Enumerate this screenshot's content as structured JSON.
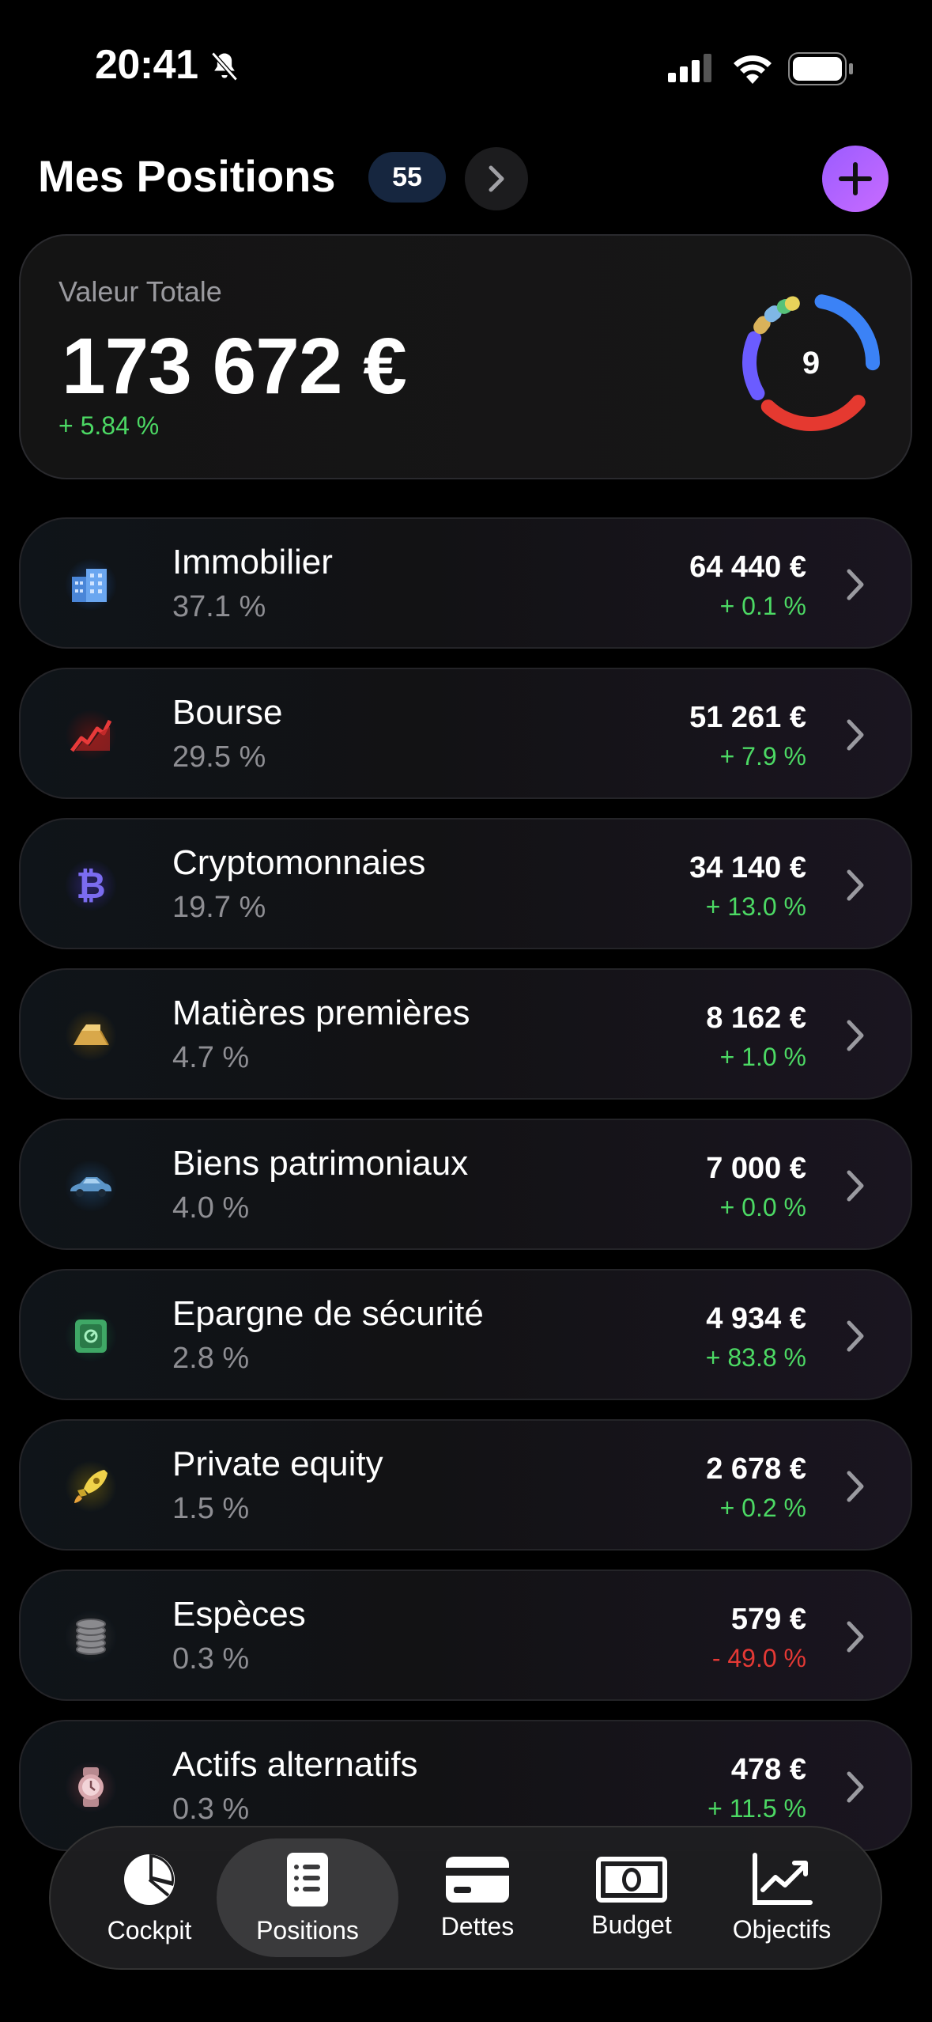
{
  "status": {
    "time": "20:41"
  },
  "header": {
    "title": "Mes Positions",
    "count": "55"
  },
  "total": {
    "label": "Valeur Totale",
    "value": "173 672 €",
    "change": "+ 5.84 %",
    "donut_count": "9"
  },
  "categories": [
    {
      "name": "Immobilier",
      "percent": "37.1 %",
      "amount": "64 440 €",
      "change": "+ 0.1 %",
      "trend": "pos",
      "icon": "building-icon"
    },
    {
      "name": "Bourse",
      "percent": "29.5 %",
      "amount": "51 261 €",
      "change": "+ 7.9 %",
      "trend": "pos",
      "icon": "stock-chart-icon"
    },
    {
      "name": "Cryptomonnaies",
      "percent": "19.7 %",
      "amount": "34 140 €",
      "change": "+ 13.0 %",
      "trend": "pos",
      "icon": "bitcoin-icon"
    },
    {
      "name": "Matières premières",
      "percent": "4.7 %",
      "amount": "8 162 €",
      "change": "+ 1.0 %",
      "trend": "pos",
      "icon": "gold-bar-icon"
    },
    {
      "name": "Biens patrimoniaux",
      "percent": "4.0 %",
      "amount": "7 000 €",
      "change": "+ 0.0 %",
      "trend": "pos",
      "icon": "car-icon"
    },
    {
      "name": "Epargne de sécurité",
      "percent": "2.8 %",
      "amount": "4 934 €",
      "change": "+ 83.8 %",
      "trend": "pos",
      "icon": "safe-icon"
    },
    {
      "name": "Private equity",
      "percent": "1.5 %",
      "amount": "2 678 €",
      "change": "+ 0.2 %",
      "trend": "pos",
      "icon": "rocket-icon"
    },
    {
      "name": "Espèces",
      "percent": "0.3 %",
      "amount": "579 €",
      "change": "- 49.0 %",
      "trend": "neg",
      "icon": "coins-icon"
    },
    {
      "name": "Actifs alternatifs",
      "percent": "0.3 %",
      "amount": "478 €",
      "change": "+ 11.5 %",
      "trend": "pos",
      "icon": "watch-icon"
    }
  ],
  "tabs": [
    {
      "label": "Cockpit",
      "icon": "pie-chart-icon"
    },
    {
      "label": "Positions",
      "icon": "list-icon",
      "active": true
    },
    {
      "label": "Dettes",
      "icon": "credit-card-icon"
    },
    {
      "label": "Budget",
      "icon": "banknote-icon"
    },
    {
      "label": "Objectifs",
      "icon": "trend-chart-icon"
    }
  ],
  "colors": {
    "positive": "#4cd964",
    "negative": "#e53935",
    "accent": "#b066ff",
    "badge": "#16263f"
  }
}
